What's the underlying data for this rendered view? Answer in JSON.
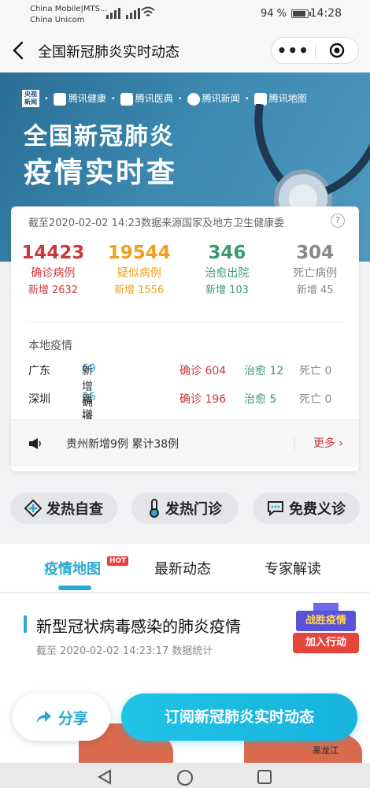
{
  "status_bar": {
    "carrier1": "China Mobile|MTS...",
    "carrier2": "China Unicom",
    "battery": "94 %",
    "time": "14:28"
  },
  "nav": {
    "title": "全国新冠肺炎实时动态",
    "back_icon": "chevron-left-icon",
    "more_icon": "more-dots-icon",
    "close_icon": "target-icon"
  },
  "banner": {
    "partners": [
      "央视新闻",
      "腾讯健康",
      "腾讯医典",
      "腾讯新闻",
      "腾讯地图"
    ],
    "title_line1": "全国新冠肺炎",
    "title_line2": "疫情实时查"
  },
  "summary": {
    "asof": "截至2020-02-02 14:23数据来源国家及地方卫生健康委",
    "stats": [
      {
        "value": "14423",
        "label": "确诊病例",
        "delta": "新增 2632",
        "color": "#c93a3a",
        "delta_color": "#c93a3a"
      },
      {
        "value": "19544",
        "label": "疑似病例",
        "delta": "新增 1556",
        "color": "#f0a020",
        "delta_color": "#f0a020"
      },
      {
        "value": "346",
        "label": "治愈出院",
        "delta": "新增 103",
        "color": "#3a9a70",
        "delta_color": "#3a9a70"
      },
      {
        "value": "304",
        "label": "死亡病例",
        "delta": "新增 45",
        "color": "#888888",
        "delta_color": "#888888"
      }
    ],
    "local_title": "本地疫情",
    "local_rows": [
      {
        "city": "广东",
        "new_label": "新增确诊",
        "new_value": "69",
        "confirmed": "确诊 604",
        "cured": "治愈 12",
        "dead": "死亡 0"
      },
      {
        "city": "深圳",
        "new_label": "新增确诊",
        "new_value": "26",
        "confirmed": "确诊 196",
        "cured": "治愈 5",
        "dead": "死亡 0"
      }
    ],
    "notice": "贵州新增9例 累计38例",
    "notice_more": "更多"
  },
  "pills": [
    {
      "label": "发热自查",
      "icon": "plus-circle-icon"
    },
    {
      "label": "发热门诊",
      "icon": "thermometer-icon"
    },
    {
      "label": "免费义诊",
      "icon": "chat-icon"
    }
  ],
  "tabs": [
    {
      "label": "疫情地图",
      "badge": "HOT"
    },
    {
      "label": "最新动态"
    },
    {
      "label": "专家解读"
    }
  ],
  "section": {
    "title": "新型冠状病毒感染的肺炎疫情",
    "subtitle": "截至 2020-02-02 14:23:17 数据统计",
    "promo_top": "战胜疫情",
    "promo_bottom": "加入行动",
    "map_label": "黑龙江"
  },
  "actions": {
    "share": "分享",
    "subscribe": "订阅新冠肺炎实时动态"
  },
  "colors": {
    "accent": "#2aaad0",
    "confirmed": "#c93a3a"
  }
}
